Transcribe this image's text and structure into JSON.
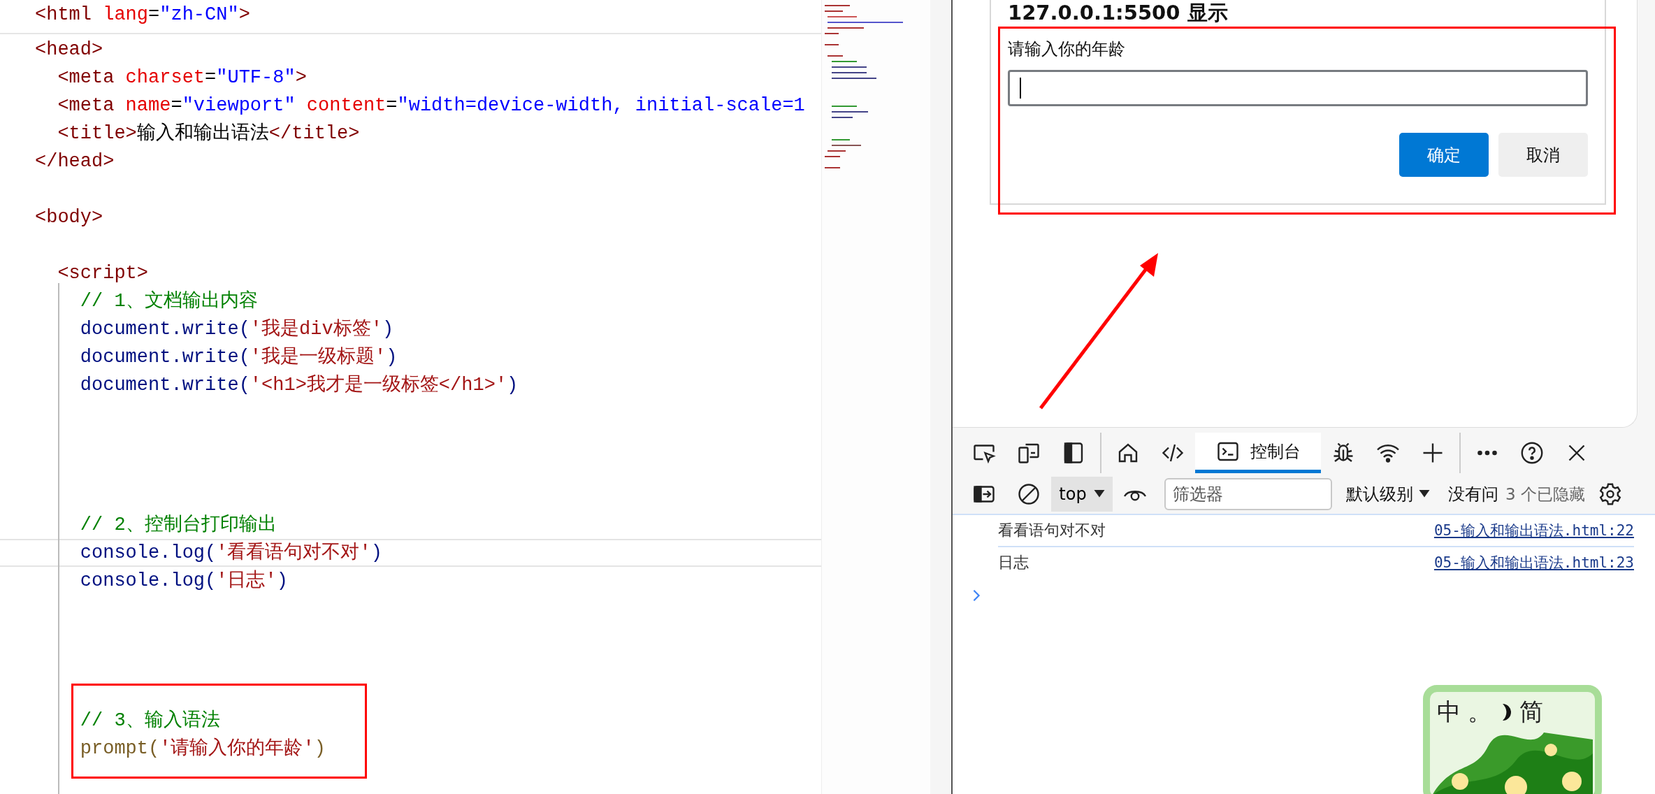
{
  "editor": {
    "lines": [
      {
        "kind": "code",
        "current": false,
        "tokens": [
          {
            "kind": "tag",
            "text": "<html"
          },
          {
            "kind": "attr",
            "text": " lang"
          },
          {
            "kind": "punct",
            "text": "="
          },
          {
            "kind": "value",
            "text": "\"zh-CN\""
          },
          {
            "kind": "tag",
            "text": ">"
          }
        ]
      },
      {
        "kind": "code",
        "current": false,
        "tokens": [
          {
            "kind": "tag",
            "text": "<head>"
          }
        ]
      },
      {
        "kind": "code",
        "current": false,
        "tokens": [
          {
            "kind": "tag",
            "text": "  <meta"
          },
          {
            "kind": "attr",
            "text": " charset"
          },
          {
            "kind": "punct",
            "text": "="
          },
          {
            "kind": "value",
            "text": "\"UTF-8\""
          },
          {
            "kind": "tag",
            "text": ">"
          }
        ]
      },
      {
        "kind": "code",
        "current": false,
        "tokens": [
          {
            "kind": "tag",
            "text": "  <meta"
          },
          {
            "kind": "attr",
            "text": " name"
          },
          {
            "kind": "punct",
            "text": "="
          },
          {
            "kind": "value",
            "text": "\"viewport\""
          },
          {
            "kind": "attr",
            "text": " content"
          },
          {
            "kind": "punct",
            "text": "="
          },
          {
            "kind": "value",
            "text": "\"width=device-width, initial-scale=1"
          }
        ]
      },
      {
        "kind": "code",
        "current": false,
        "tokens": [
          {
            "kind": "tag",
            "text": "  <title>"
          },
          {
            "kind": "plain",
            "text": "输入和输出语法"
          },
          {
            "kind": "tag",
            "text": "</title>"
          }
        ]
      },
      {
        "kind": "code",
        "current": false,
        "tokens": [
          {
            "kind": "tag",
            "text": "</head>"
          }
        ]
      },
      {
        "kind": "blank"
      },
      {
        "kind": "code",
        "current": false,
        "tokens": [
          {
            "kind": "tag",
            "text": "<body>"
          }
        ]
      },
      {
        "kind": "blank"
      },
      {
        "kind": "code",
        "current": false,
        "tokens": [
          {
            "kind": "tag",
            "text": "  <script>"
          }
        ]
      },
      {
        "kind": "code",
        "current": false,
        "tokens": [
          {
            "kind": "comment",
            "text": "    // 1、文档输出内容"
          }
        ]
      },
      {
        "kind": "code",
        "current": false,
        "tokens": [
          {
            "kind": "obj",
            "text": "    document.write("
          },
          {
            "kind": "str",
            "text": "'我是div标签'"
          },
          {
            "kind": "obj",
            "text": ")"
          }
        ]
      },
      {
        "kind": "code",
        "current": false,
        "tokens": [
          {
            "kind": "obj",
            "text": "    document.write("
          },
          {
            "kind": "str",
            "text": "'我是一级标题'"
          },
          {
            "kind": "obj",
            "text": ")"
          }
        ]
      },
      {
        "kind": "code",
        "current": false,
        "tokens": [
          {
            "kind": "obj",
            "text": "    document.write("
          },
          {
            "kind": "str",
            "text": "'<h1>我才是一级标签</h1>'"
          },
          {
            "kind": "obj",
            "text": ")"
          }
        ]
      },
      {
        "kind": "blank"
      },
      {
        "kind": "blank"
      },
      {
        "kind": "blank"
      },
      {
        "kind": "blank"
      },
      {
        "kind": "code",
        "current": false,
        "tokens": [
          {
            "kind": "comment",
            "text": "    // 2、控制台打印输出"
          }
        ]
      },
      {
        "kind": "code",
        "current": true,
        "tokens": [
          {
            "kind": "obj",
            "text": "    console.log("
          },
          {
            "kind": "str",
            "text": "'看看语句对不对'"
          },
          {
            "kind": "obj",
            "text": ")"
          }
        ]
      },
      {
        "kind": "code",
        "current": false,
        "tokens": [
          {
            "kind": "obj",
            "text": "    console.log("
          },
          {
            "kind": "str",
            "text": "'日志'"
          },
          {
            "kind": "obj",
            "text": ")"
          }
        ]
      },
      {
        "kind": "blank"
      },
      {
        "kind": "blank"
      },
      {
        "kind": "blank"
      },
      {
        "kind": "blank"
      },
      {
        "kind": "code",
        "current": false,
        "tokens": [
          {
            "kind": "comment",
            "text": "    // 3、输入语法"
          }
        ]
      },
      {
        "kind": "code",
        "current": false,
        "tokens": [
          {
            "kind": "fn",
            "text": "    prompt("
          },
          {
            "kind": "str",
            "text": "'请输入你的年龄'"
          },
          {
            "kind": "fn",
            "text": ")"
          }
        ]
      }
    ]
  },
  "dialog": {
    "title": "127.0.0.1:5500 显示",
    "message": "请输入你的年龄",
    "buttons": [
      {
        "kind": "primary",
        "label": "确定"
      },
      {
        "kind": "secondary",
        "label": "取消"
      }
    ]
  },
  "devtools": {
    "tools": [
      {
        "kind": "inspect",
        "selected": false
      },
      {
        "kind": "device",
        "selected": false
      },
      {
        "kind": "dock",
        "selected": false
      },
      {
        "kind": "divider"
      },
      {
        "kind": "home",
        "selected": false
      },
      {
        "kind": "code",
        "selected": false
      },
      {
        "kind": "console",
        "label": "控制台",
        "selected": true
      },
      {
        "kind": "bug",
        "selected": false
      },
      {
        "kind": "wifi",
        "selected": false
      },
      {
        "kind": "plus",
        "selected": false
      },
      {
        "kind": "divider"
      },
      {
        "kind": "more",
        "selected": false
      },
      {
        "kind": "help",
        "selected": false
      },
      {
        "kind": "close",
        "selected": false
      }
    ],
    "console_toolbar": {
      "context": "top",
      "filter_placeholder": "筛选器",
      "level": "默认级别",
      "issues": "没有问",
      "hidden": "3 个已隐藏"
    },
    "messages": [
      {
        "text": "看看语句对不对",
        "source": "05-输入和输出语法.html:22"
      },
      {
        "text": "日志",
        "source": "05-输入和输出语法.html:23"
      }
    ]
  },
  "ime": {
    "mode": "中",
    "punct": "。",
    "charset": "简"
  }
}
